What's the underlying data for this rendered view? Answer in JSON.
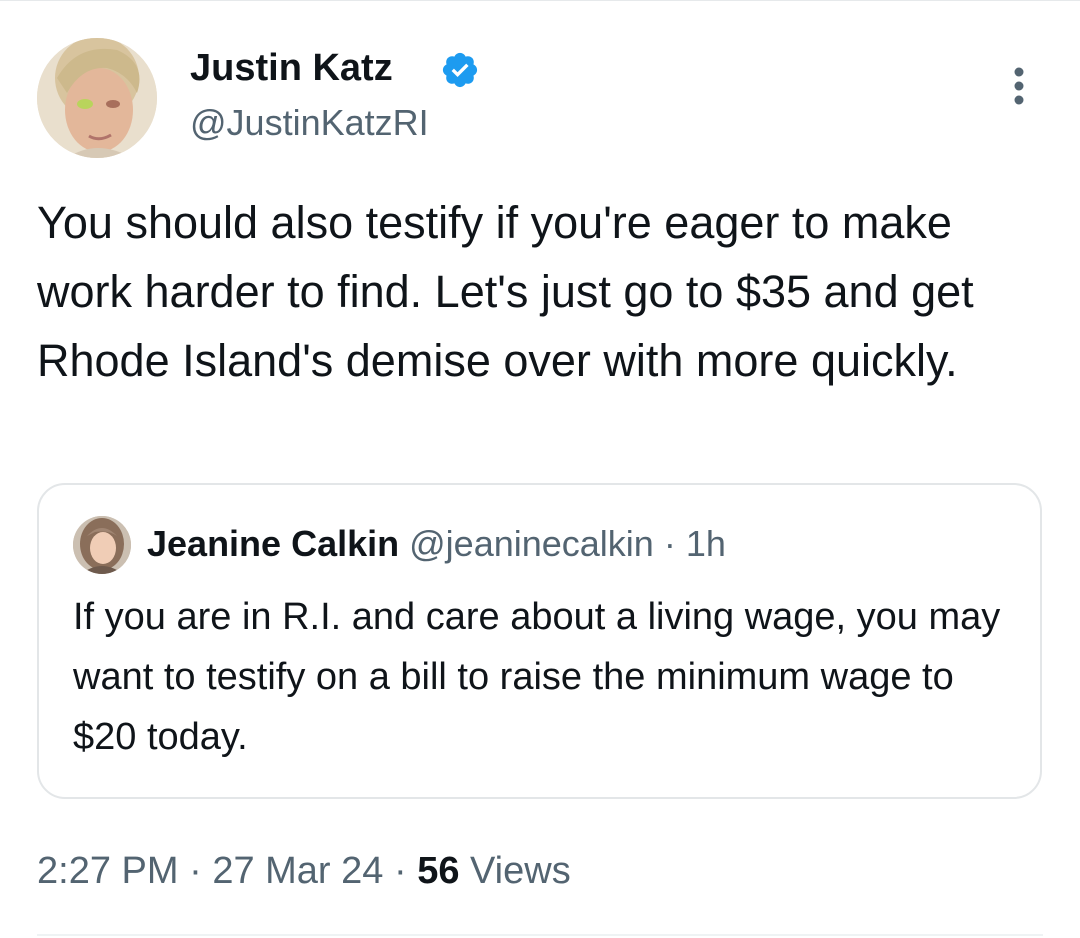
{
  "tweet": {
    "author": {
      "name": "Justin Katz",
      "handle": "@JustinKatzRI",
      "verified": true,
      "avatar_icon": "profile-photo-icon"
    },
    "text": "You should also testify if you're eager to make work harder to find. Let's just go to $35 and get Rhode Island's demise over with more quickly.",
    "quoted_tweet": {
      "name": "Jeanine Calkin",
      "handle": "@jeaninecalkin",
      "separator": " · ",
      "time": "1h",
      "text": "If you are in R.I. and care about a living wage, you may want to testify on a bill to raise the minimum wage to $20 today."
    },
    "footer": {
      "time": "2:27 PM",
      "separator": " · ",
      "date": "27 Mar 24",
      "separator2": " · ",
      "views_count": "56",
      "views_label": " Views"
    }
  },
  "colors": {
    "text_primary": "#0f1419",
    "text_secondary": "#536471",
    "verified_badge": "#1d9bf0",
    "border": "#e3e6e8"
  }
}
